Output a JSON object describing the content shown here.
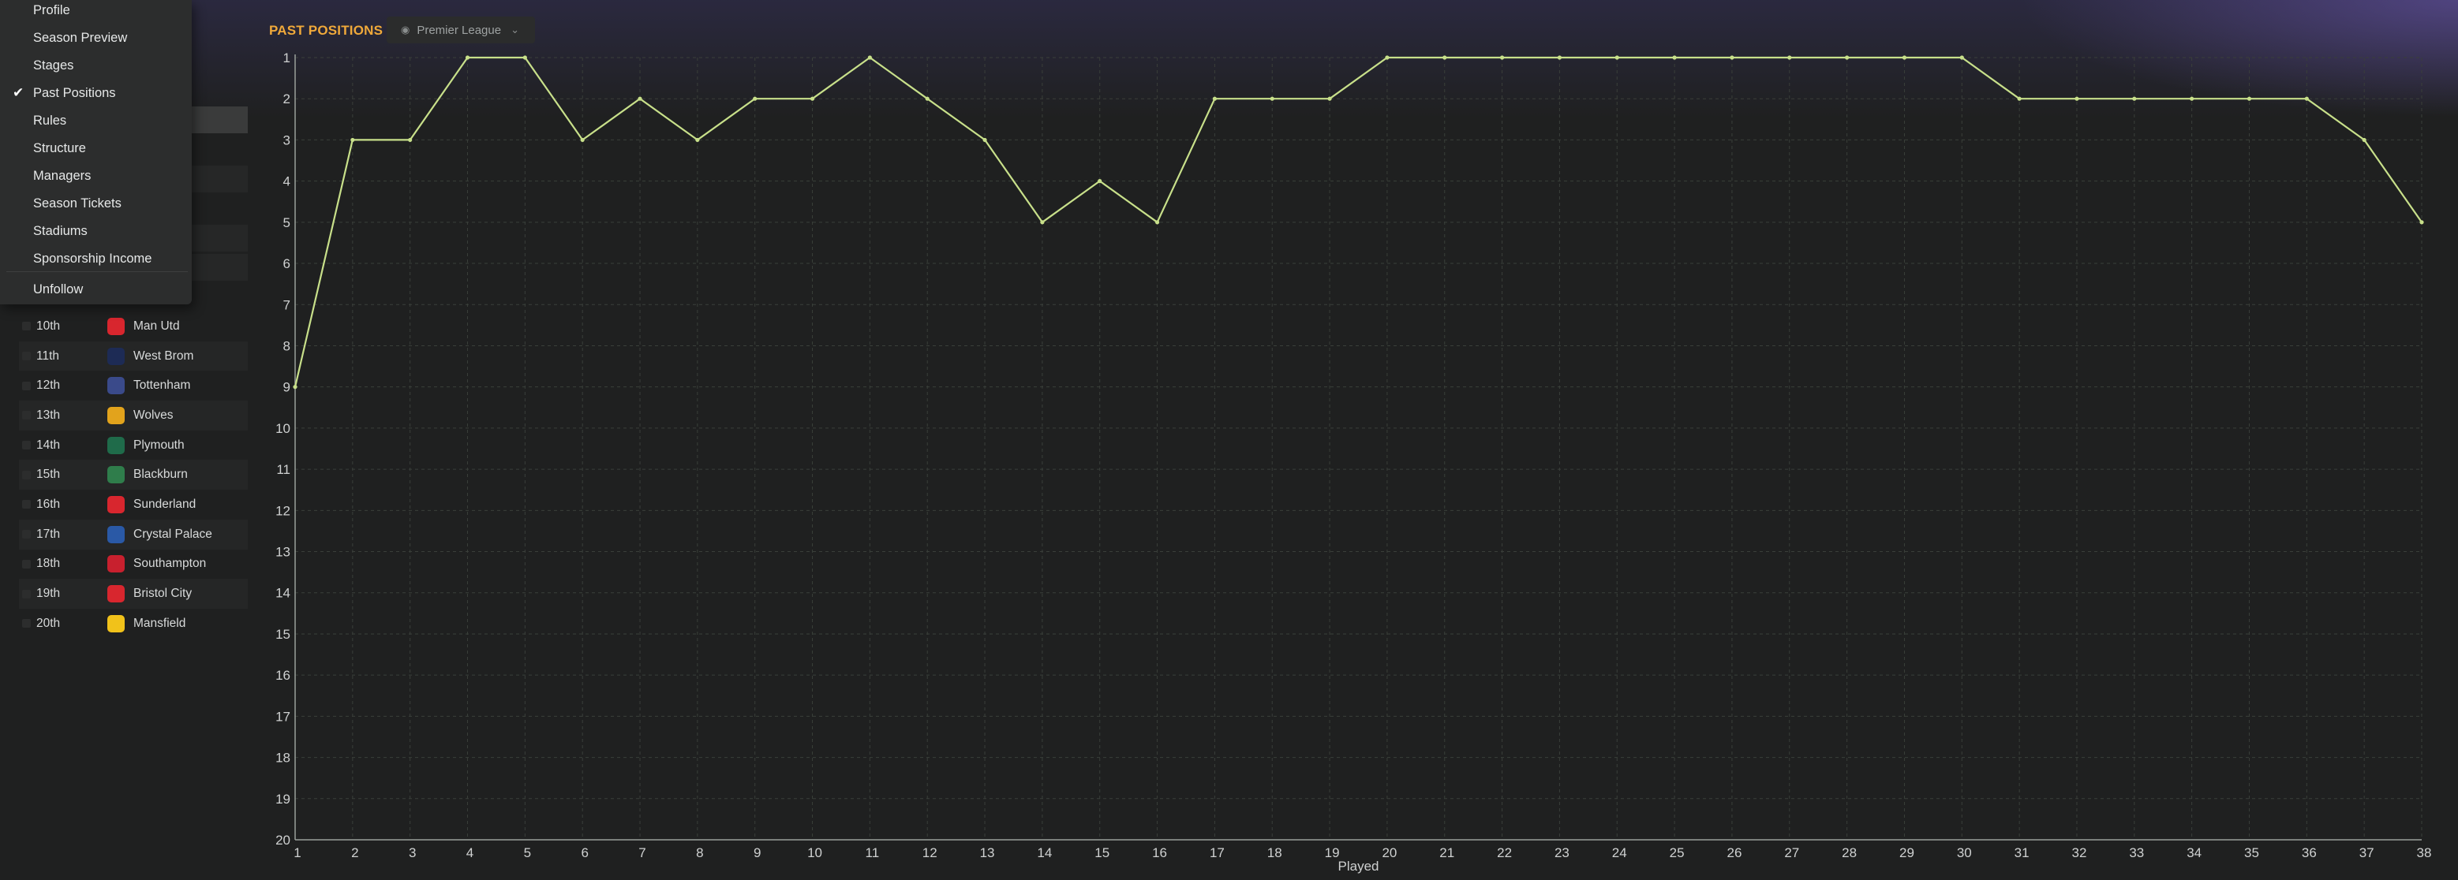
{
  "header": {
    "title": "PAST POSITIONS",
    "competition": "Premier League"
  },
  "menu": {
    "items": [
      "Profile",
      "Season Preview",
      "Stages",
      "Past Positions",
      "Rules",
      "Structure",
      "Managers",
      "Season Tickets",
      "Stadiums",
      "Sponsorship Income"
    ],
    "checked_item": "Past Positions",
    "unfollow_label": "Unfollow"
  },
  "standings": [
    {
      "pos": "10th",
      "team": "Man Utd",
      "color": "#d8262e"
    },
    {
      "pos": "11th",
      "team": "West Brom",
      "color": "#1d2b55"
    },
    {
      "pos": "12th",
      "team": "Tottenham",
      "color": "#3a4a8a"
    },
    {
      "pos": "13th",
      "team": "Wolves",
      "color": "#e2a31c"
    },
    {
      "pos": "14th",
      "team": "Plymouth",
      "color": "#1f6b4a"
    },
    {
      "pos": "15th",
      "team": "Blackburn",
      "color": "#2f7d4b"
    },
    {
      "pos": "16th",
      "team": "Sunderland",
      "color": "#d8262e"
    },
    {
      "pos": "17th",
      "team": "Crystal Palace",
      "color": "#2a59a6"
    },
    {
      "pos": "18th",
      "team": "Southampton",
      "color": "#c8202e"
    },
    {
      "pos": "19th",
      "team": "Bristol City",
      "color": "#d8262e"
    },
    {
      "pos": "20th",
      "team": "Mansfield",
      "color": "#f1c21a"
    }
  ],
  "colors": {
    "accent": "#f0a93a",
    "line": "#c8e08a",
    "grid": "#3a3f3a"
  },
  "chart_data": {
    "type": "line",
    "title": "",
    "xlabel": "Played",
    "ylabel": "",
    "x": [
      1,
      2,
      3,
      4,
      5,
      6,
      7,
      8,
      9,
      10,
      11,
      12,
      13,
      14,
      15,
      16,
      17,
      18,
      19,
      20,
      21,
      22,
      23,
      24,
      25,
      26,
      27,
      28,
      29,
      30,
      31,
      32,
      33,
      34,
      35,
      36,
      37,
      38
    ],
    "y": [
      9,
      3,
      3,
      1,
      1,
      3,
      2,
      3,
      2,
      2,
      1,
      2,
      3,
      5,
      4,
      5,
      2,
      2,
      2,
      1,
      1,
      1,
      1,
      1,
      1,
      1,
      1,
      1,
      1,
      1,
      2,
      2,
      2,
      2,
      2,
      2,
      3,
      5
    ],
    "xlim": [
      1,
      38
    ],
    "ylim": [
      1,
      20
    ],
    "y_inverted": true,
    "yticks": [
      "1",
      "2",
      "3",
      "4",
      "5",
      "6",
      "7",
      "8",
      "9",
      "10",
      "11",
      "12",
      "13",
      "14",
      "15",
      "16",
      "17",
      "18",
      "19",
      "20"
    ],
    "xticks": [
      "1",
      "2",
      "3",
      "4",
      "5",
      "6",
      "7",
      "8",
      "9",
      "10",
      "11",
      "12",
      "13",
      "14",
      "15",
      "16",
      "17",
      "18",
      "19",
      "20",
      "21",
      "22",
      "23",
      "24",
      "25",
      "26",
      "27",
      "28",
      "29",
      "30",
      "31",
      "32",
      "33",
      "34",
      "35",
      "36",
      "37",
      "38"
    ],
    "grid": true
  }
}
